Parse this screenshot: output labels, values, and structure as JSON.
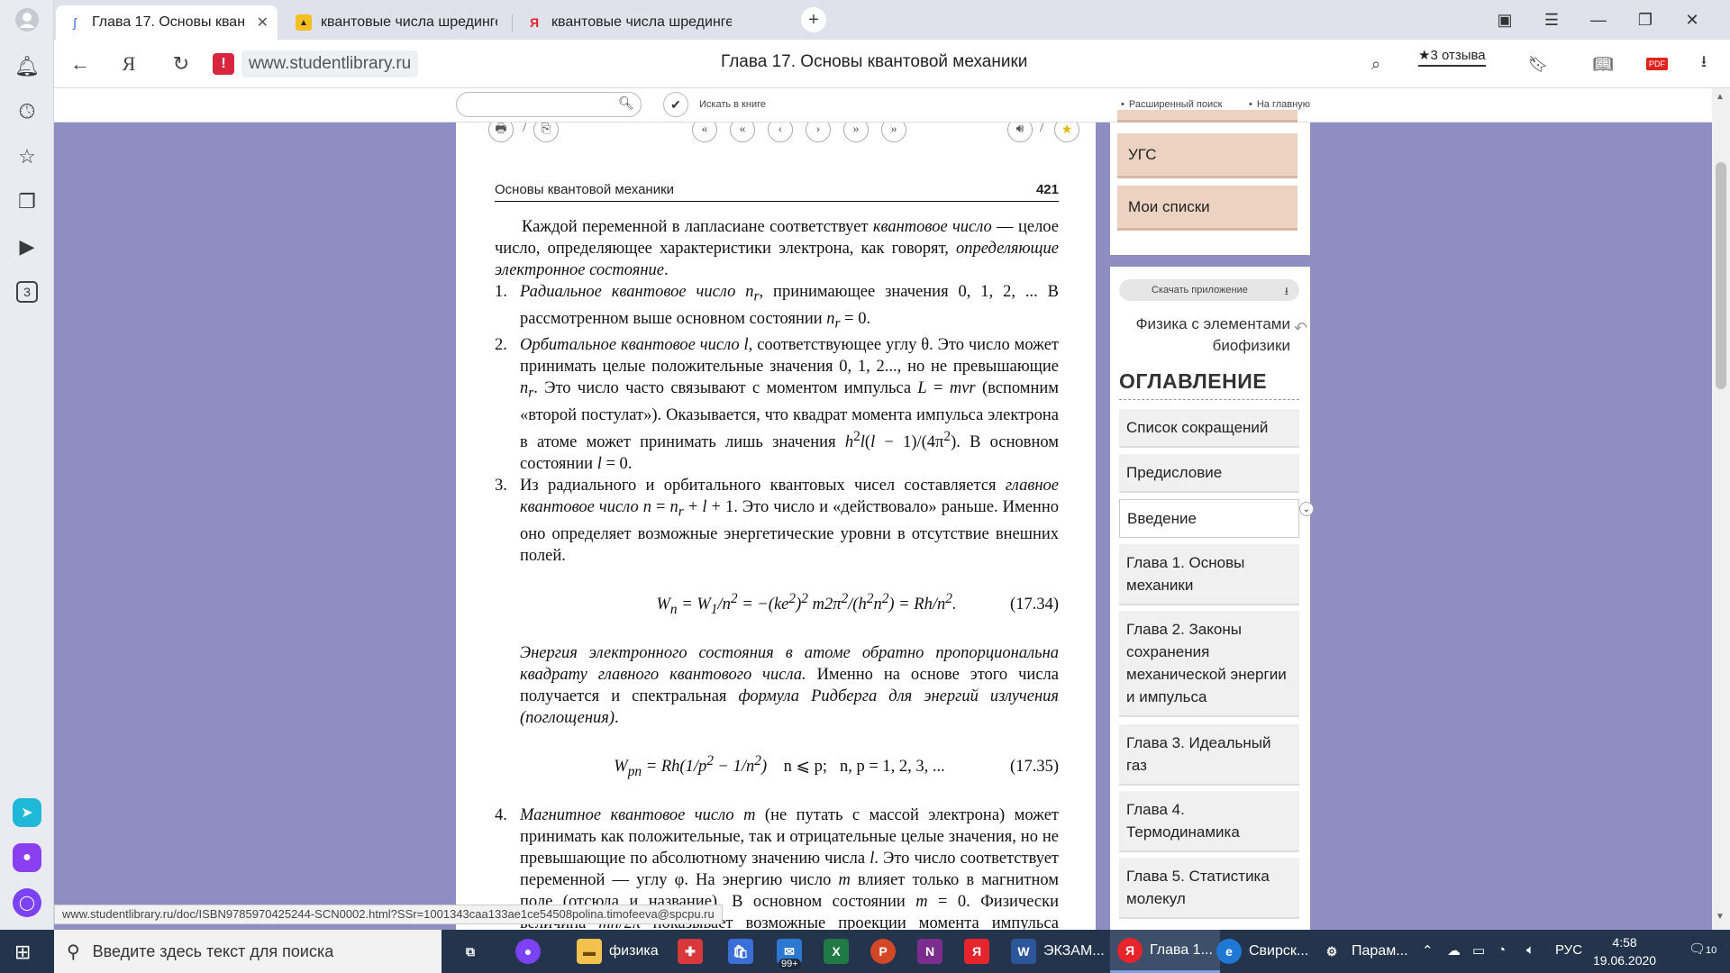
{
  "browser": {
    "tabs": [
      {
        "title": "Глава 17. Основы квантовой механики",
        "active": true
      },
      {
        "title": "квантовые числа шредингера",
        "active": false
      },
      {
        "title": "квантовые числа шредингера",
        "active": false
      }
    ],
    "url_domain": "www.studentlibrary.ru",
    "page_title": "Глава 17. Основы квантовой механики",
    "reviews_label": "★3 отзыва",
    "status_url": "www.studentlibrary.ru/doc/ISBN9785970425244-SCN0002.html?SSr=1001343caa133ae1ce54508polina.timofeeva@spcpu.ru",
    "rail_badge": "3"
  },
  "site_toolbar": {
    "search_placeholder": "",
    "search_in_book": "Искать в книге",
    "advanced_search": "Расширенный поиск",
    "home_link": "На главную"
  },
  "pager": {
    "page_sep_left": "/",
    "page_sep_right": "/"
  },
  "book": {
    "running_head": "Основы квантовой механики",
    "page_number": "421",
    "formula_1_number": "(17.34)",
    "formula_2_number": "(17.35)"
  },
  "sidebar": {
    "top_buttons": [
      "УГС",
      "Мои списки"
    ],
    "download_app": "Скачать приложение",
    "book_title": "Физика с элементами биофизики",
    "toc_heading": "ОГЛАВЛЕНИЕ",
    "toc_items": [
      "Список сокращений",
      "Предисловие",
      "Введение",
      "Глава 1. Основы механики",
      "Глава 2. Законы сохранения механической энергии и импульса",
      "Глава 3. Идеальный газ",
      "Глава 4. Термодинамика",
      "Глава 5. Статистика молекул"
    ]
  },
  "taskbar": {
    "search_placeholder": "Введите здесь текст для поиска",
    "items": [
      "физика",
      "ЭКЗАМ...",
      "Глава 1...",
      "Свирск...",
      "Парам..."
    ],
    "store_badge": "99+",
    "language": "РУС",
    "time": "4:58",
    "date": "19.06.2020",
    "notifications": "10"
  },
  "colors": {
    "page_background": "#8e8ec3",
    "peach_button": "#ecd2c0",
    "taskbar": "#24344d",
    "warning_red": "#d7263d"
  }
}
